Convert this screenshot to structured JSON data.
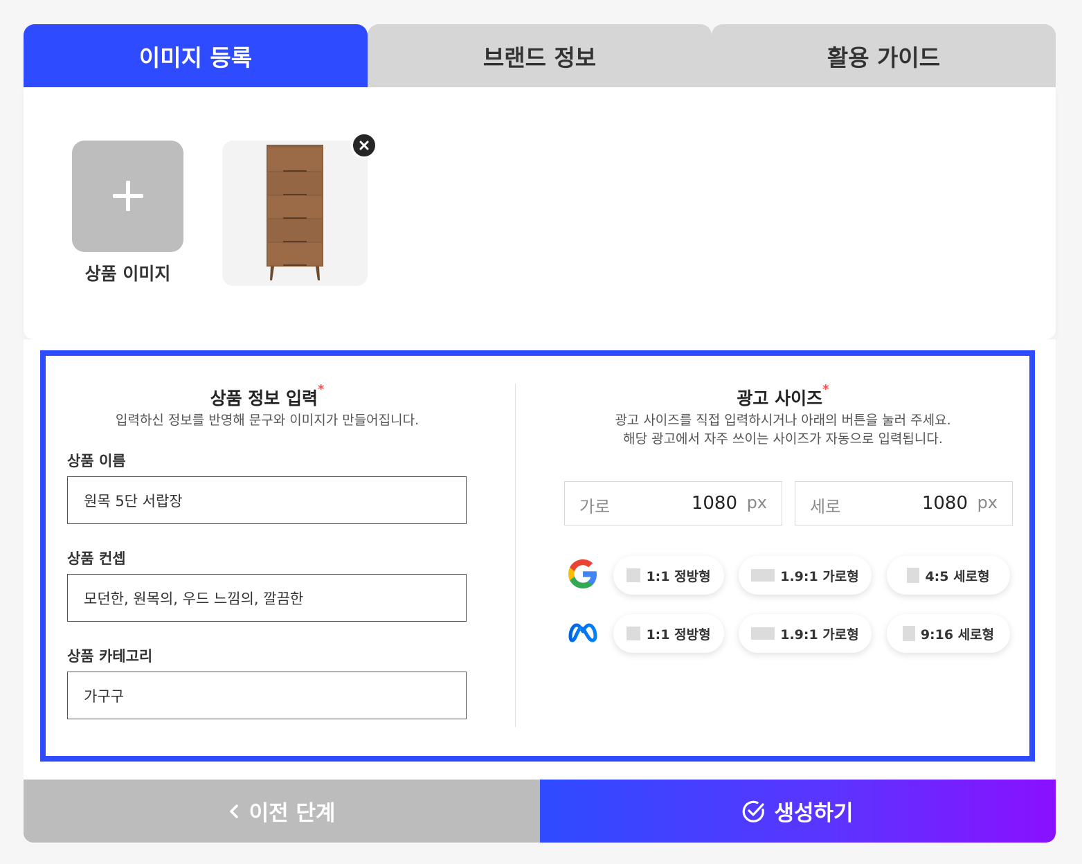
{
  "tabs": [
    {
      "label": "이미지 등록"
    },
    {
      "label": "브랜드 정보"
    },
    {
      "label": "활용 가이드"
    }
  ],
  "upload": {
    "add_label": "상품 이미지"
  },
  "product_info": {
    "title": "상품 정보 입력",
    "required_mark": "*",
    "description": "입력하신 정보를 반영해 문구와 이미지가 만들어집니다.",
    "fields": [
      {
        "label": "상품 이름",
        "value": "원목 5단 서랍장"
      },
      {
        "label": "상품 컨셉",
        "value": "모던한, 원목의, 우드 느낌의, 깔끔한"
      },
      {
        "label": "상품 카테고리",
        "value": "가구구"
      }
    ]
  },
  "ad_size": {
    "title": "광고 사이즈",
    "required_mark": "*",
    "description_line1": "광고 사이즈를 직접 입력하시거나 아래의 버튼을 눌러 주세요.",
    "description_line2": "해당 광고에서 자주 쓰이는 사이즈가 자동으로 입력됩니다.",
    "width": {
      "label": "가로",
      "value": "1080",
      "unit": "px"
    },
    "height": {
      "label": "세로",
      "value": "1080",
      "unit": "px"
    },
    "platforms": [
      {
        "icon": "google-logo-icon",
        "presets": [
          "1:1 정방형",
          "1.9:1 가로형",
          "4:5 세로형"
        ]
      },
      {
        "icon": "meta-logo-icon",
        "presets": [
          "1:1 정방형",
          "1.9:1 가로형",
          "9:16 세로형"
        ]
      }
    ]
  },
  "actions": {
    "prev_label": "이전 단계",
    "generate_label": "생성하기"
  },
  "colors": {
    "accent": "#2e4bff",
    "gradient_end": "#8a10ff",
    "required": "#ff4a4a"
  }
}
